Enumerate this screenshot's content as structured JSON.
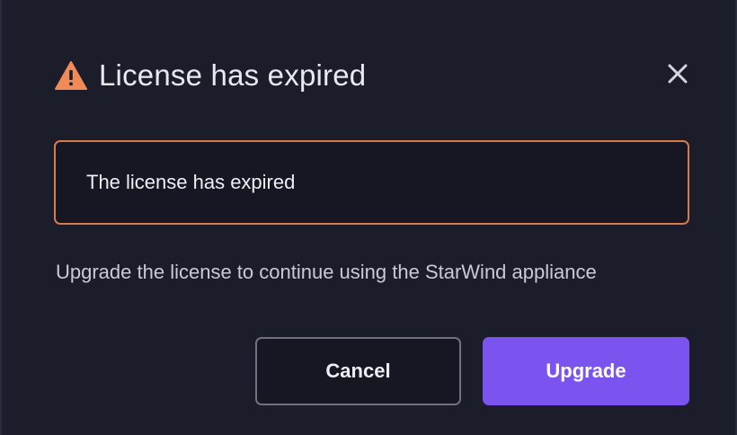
{
  "dialog": {
    "title": "License has expired",
    "title_icon": "warning-triangle-icon",
    "close_icon": "close-icon",
    "alert_message": "The license has expired",
    "description": "Upgrade the license to continue using the StarWind appliance",
    "buttons": {
      "cancel_label": "Cancel",
      "upgrade_label": "Upgrade"
    }
  },
  "colors": {
    "background": "#1b1d2b",
    "warning": "#f08a56",
    "alert_border": "#d97a4a",
    "primary_button": "#7b54f0",
    "text": "#e8e9ee"
  }
}
